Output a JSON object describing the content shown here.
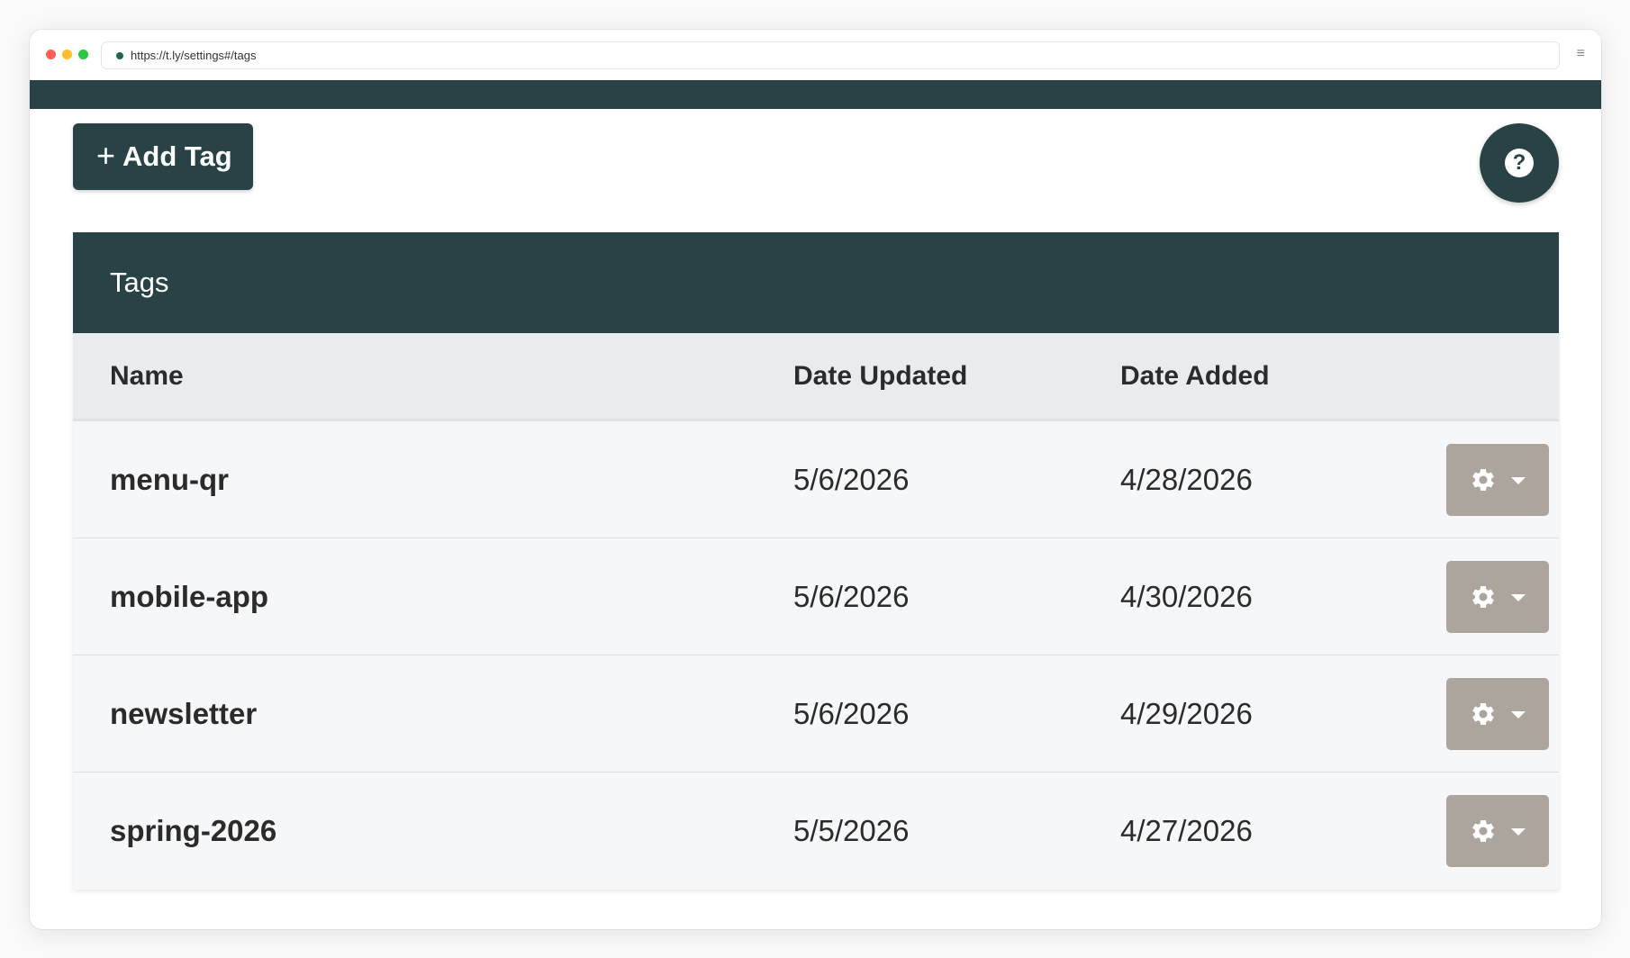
{
  "browser": {
    "url": "https://t.ly/settings#/tags",
    "menu_icon": "≡"
  },
  "toolbar": {
    "add_label": "Add Tag",
    "add_icon": "+",
    "help_icon": "?"
  },
  "tags_table": {
    "title": "Tags",
    "columns": {
      "name": "Name",
      "updated": "Date Updated",
      "added": "Date Added"
    },
    "rows": [
      {
        "name": "menu-qr",
        "updated": "5/6/2026",
        "added": "4/28/2026"
      },
      {
        "name": "mobile-app",
        "updated": "5/6/2026",
        "added": "4/30/2026"
      },
      {
        "name": "newsletter",
        "updated": "5/6/2026",
        "added": "4/29/2026"
      },
      {
        "name": "spring-2026",
        "updated": "5/5/2026",
        "added": "4/27/2026"
      }
    ]
  },
  "colors": {
    "primary": "#294246",
    "action_button": "#aca59e",
    "table_header": "#e8ecef",
    "row_background": "#f5f7f9"
  }
}
